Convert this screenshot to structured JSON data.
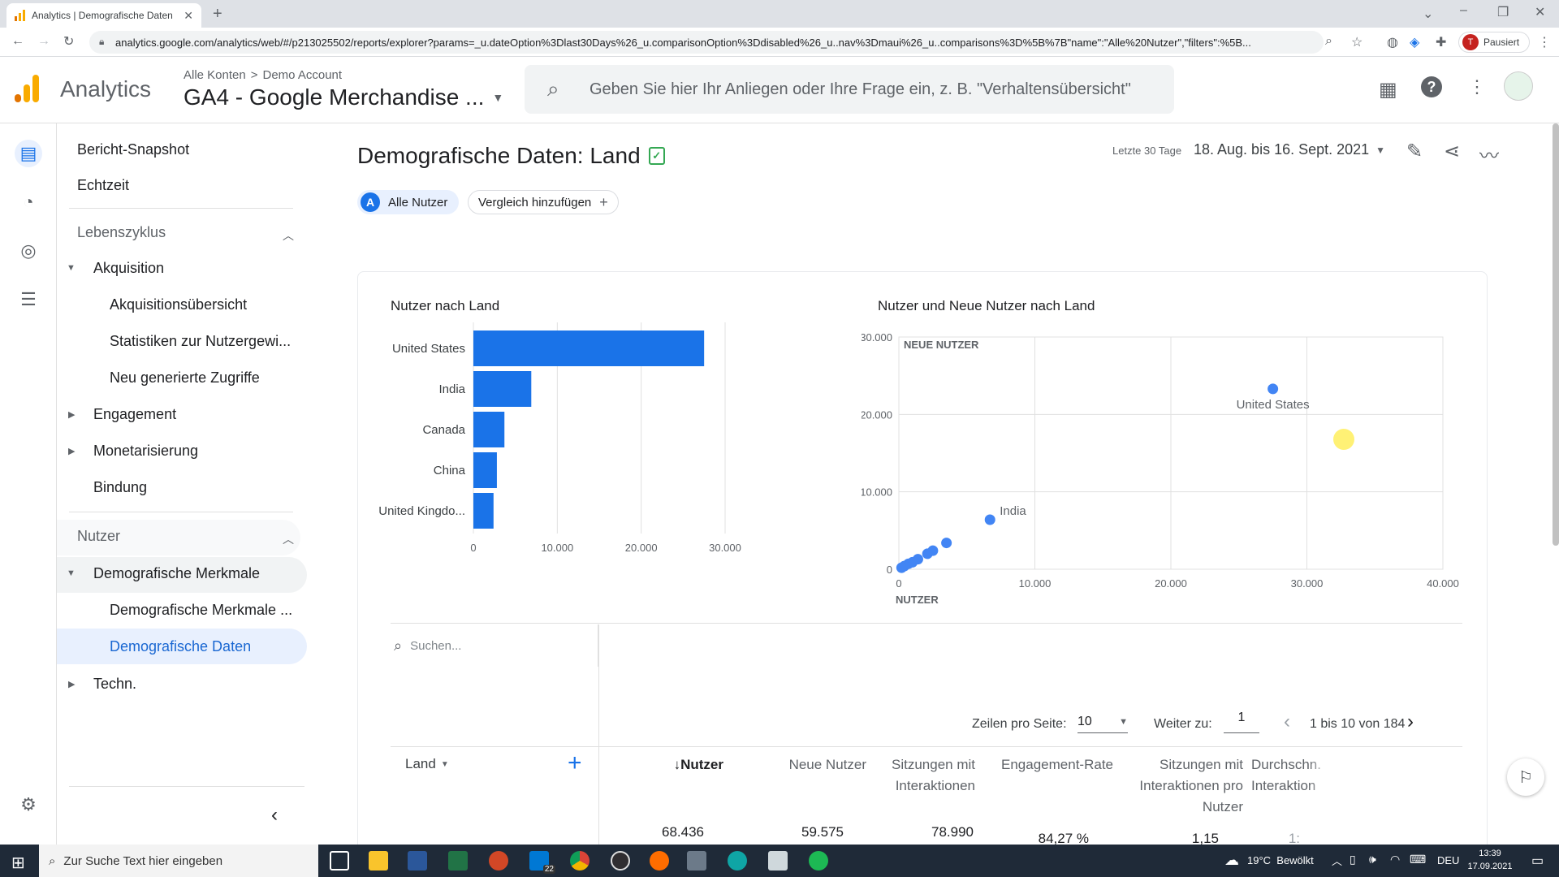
{
  "browser": {
    "tab_title": "Analytics | Demografische Daten",
    "url": "analytics.google.com/analytics/web/#/p213025502/reports/explorer?params=_u.dateOption%3Dlast30Days%26_u.comparisonOption%3Ddisabled%26_u..nav%3Dmaui%26_u..comparisons%3D%5B%7B\"name\":\"Alle%20Nutzer\",\"filters\":%5B...",
    "profile_label": "Pausiert",
    "profile_initial": "T"
  },
  "header": {
    "app_name": "Analytics",
    "breadcrumb_all": "Alle Konten",
    "breadcrumb_sep": ">",
    "breadcrumb_account": "Demo Account",
    "property": "GA4 - Google Merchandise ...",
    "search_placeholder": "Geben Sie hier Ihr Anliegen oder Ihre Frage ein, z. B. \"Verhaltensübersicht\""
  },
  "nav": {
    "snapshot": "Bericht-Snapshot",
    "realtime": "Echtzeit",
    "lifecycle": "Lebenszyklus",
    "acquisition": "Akquisition",
    "acq_items": [
      "Akquisitionsübersicht",
      "Statistiken zur Nutzergewi...",
      "Neu generierte Zugriffe"
    ],
    "engagement": "Engagement",
    "monetization": "Monetarisierung",
    "retention": "Bindung",
    "users": "Nutzer",
    "demographics": "Demografische Merkmale",
    "demo_items": [
      "Demografische Merkmale ...",
      "Demografische Daten"
    ],
    "tech": "Techn."
  },
  "report": {
    "title": "Demografische Daten: Land",
    "date_label": "Letzte 30 Tage",
    "date_range": "18. Aug. bis 16. Sept. 2021",
    "segment_letter": "A",
    "segment": "Alle Nutzer",
    "add_comparison": "Vergleich hinzufügen"
  },
  "chart_data": [
    {
      "type": "bar",
      "title": "Nutzer nach Land",
      "categories": [
        "United States",
        "India",
        "Canada",
        "China",
        "United Kingdo..."
      ],
      "values": [
        27500,
        6900,
        3700,
        2800,
        2400
      ],
      "xlim": [
        0,
        30000
      ],
      "xticks": [
        "0",
        "10.000",
        "20.000",
        "30.000"
      ],
      "color": "#1a73e8"
    },
    {
      "type": "scatter",
      "title": "Nutzer und Neue Nutzer nach Land",
      "xlabel": "NUTZER",
      "ylabel": "NEUE NUTZER",
      "xlim": [
        0,
        40000
      ],
      "ylim": [
        0,
        30000
      ],
      "xticks": [
        "0",
        "10.000",
        "20.000",
        "30.000",
        "40.000"
      ],
      "yticks": [
        "0",
        "10.000",
        "20.000",
        "30.000"
      ],
      "points": [
        {
          "x": 27500,
          "y": 23300,
          "label": "United States"
        },
        {
          "x": 6700,
          "y": 6400,
          "label": "India"
        },
        {
          "x": 3500,
          "y": 3400,
          "label": ""
        },
        {
          "x": 2500,
          "y": 2400,
          "label": ""
        },
        {
          "x": 2100,
          "y": 2000,
          "label": ""
        },
        {
          "x": 1400,
          "y": 1300,
          "label": ""
        },
        {
          "x": 1000,
          "y": 900,
          "label": ""
        },
        {
          "x": 700,
          "y": 700,
          "label": ""
        },
        {
          "x": 400,
          "y": 400,
          "label": ""
        },
        {
          "x": 200,
          "y": 200,
          "label": ""
        }
      ],
      "color": "#4285f4"
    }
  ],
  "table": {
    "search_placeholder": "Suchen...",
    "rows_label": "Zeilen pro Seite:",
    "rows_value": "10",
    "goto_label": "Weiter zu:",
    "goto_value": "1",
    "page_info": "1 bis 10 von 184",
    "dim_header": "Land",
    "headers": [
      "Nutzer",
      "Neue Nutzer",
      "Sitzungen mit Interaktionen",
      "Engagement-Rate",
      "Sitzungen mit Interaktionen pro Nutzer",
      "Durchschn. Interaktion"
    ],
    "sort_arrow": "↓",
    "totals": [
      "68.436",
      "59.575",
      "78.990",
      "84,27 %",
      "1,15",
      "1:"
    ]
  },
  "taskbar": {
    "search_placeholder": "Zur Suche Text hier eingeben",
    "weather": "19°C  Bewölkt",
    "lang": "DEU",
    "time": "13:39",
    "date": "17.09.2021",
    "mail_badge": "22"
  }
}
